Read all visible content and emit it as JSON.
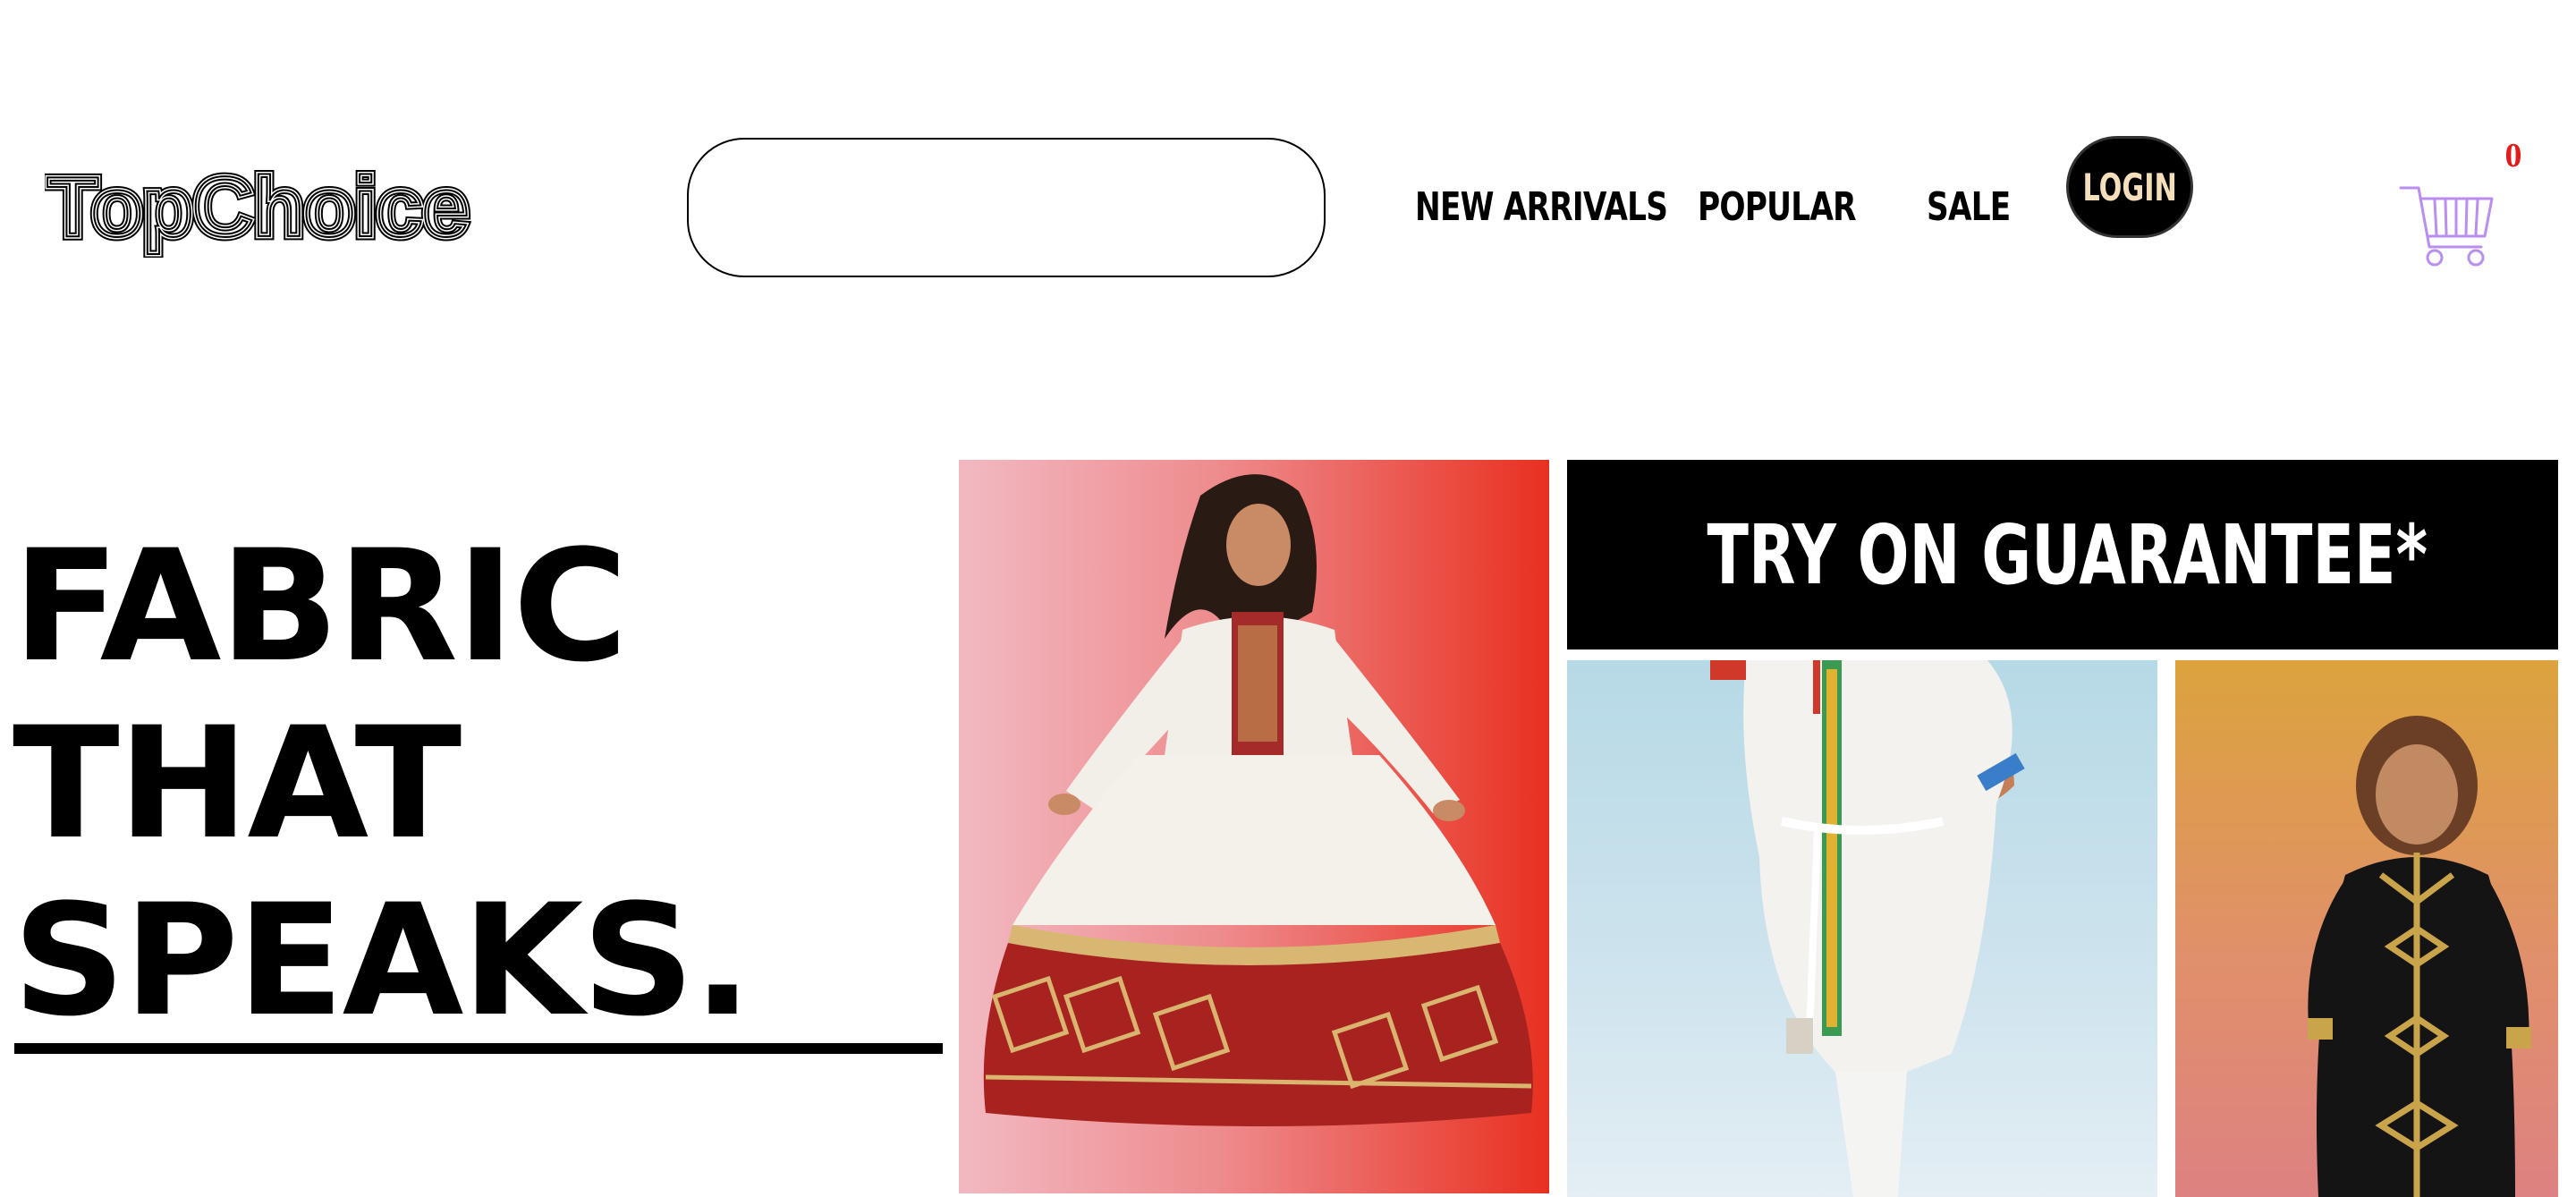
{
  "header": {
    "logo_text": "TopChoice",
    "search": {
      "placeholder": "",
      "value": ""
    },
    "nav": [
      "NEW ARRIVALS",
      "POPULAR",
      "SALE"
    ],
    "login_label": "LOGIN",
    "cart": {
      "icon": "shopping-cart-icon",
      "count": "0",
      "count_color": "#e21b1b"
    }
  },
  "hero": {
    "lines": [
      "FABRIC",
      "THAT",
      "SPEAKS."
    ]
  },
  "promo": {
    "banner_text": "TRY ON GUARANTEE*"
  },
  "colors": {
    "red_panel": "#e83020",
    "blue_panel": "#b6d9e6",
    "orange_panel": "#dca33d",
    "login_text": "#f5dfba"
  }
}
